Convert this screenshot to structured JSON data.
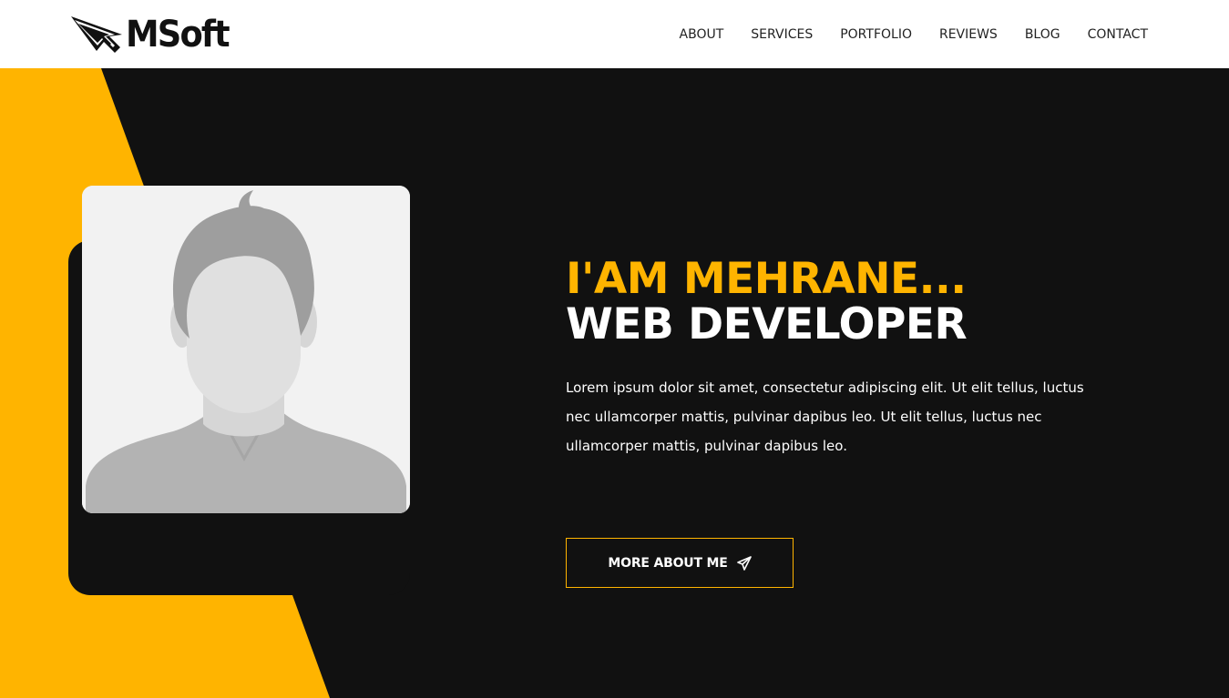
{
  "brand": {
    "name": "MSoft",
    "icon": "cursor-arrow-icon"
  },
  "nav": {
    "items": [
      {
        "label": "ABOUT"
      },
      {
        "label": "SERVICES"
      },
      {
        "label": "PORTFOLIO"
      },
      {
        "label": "REVIEWS"
      },
      {
        "label": "BLOG"
      },
      {
        "label": "CONTACT"
      }
    ]
  },
  "hero": {
    "greeting": "I'AM MEHRANE...",
    "role": "WEB DEVELOPER",
    "description": "Lorem ipsum dolor sit amet, consectetur adipiscing elit. Ut elit tellus, luctus nec ullamcorper mattis, pulvinar dapibus leo. Ut elit tellus, luctus nec ullamcorper mattis, pulvinar dapibus leo.",
    "button_label": "MORE ABOUT ME",
    "button_icon": "paper-plane-icon",
    "avatar_icon": "avatar-placeholder-icon"
  },
  "colors": {
    "accent": "#ffb400",
    "dark": "#111111",
    "header_bg": "#ffffff"
  }
}
